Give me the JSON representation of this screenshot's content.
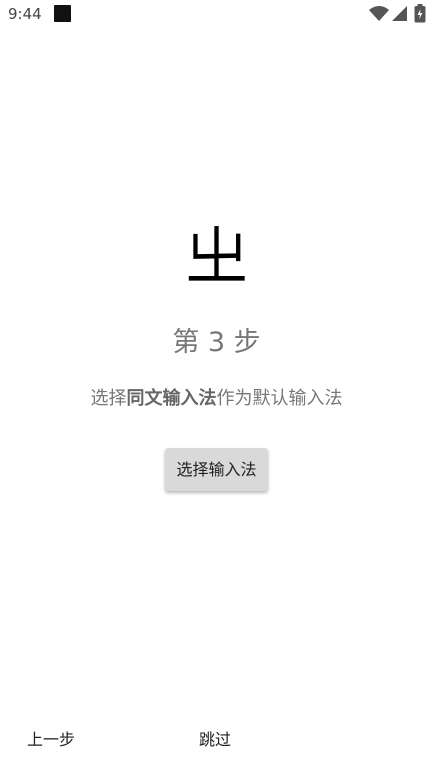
{
  "status_bar": {
    "time": "9:44"
  },
  "logo": {
    "glyph": "㞢"
  },
  "step": {
    "title": "第 3 步"
  },
  "instruction": {
    "prefix": "选择",
    "ime_name": "同文输入法",
    "suffix": "作为默认输入法"
  },
  "actions": {
    "select_ime_label": "选择输入法",
    "previous_label": "上一步",
    "skip_label": "跳过"
  }
}
